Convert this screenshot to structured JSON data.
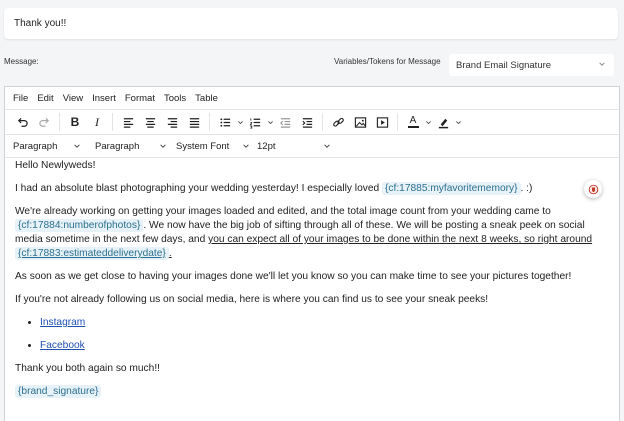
{
  "subject": {
    "value": "Thank you!!"
  },
  "message_label": "Message:",
  "variables": {
    "label": "Variables/Tokens for Message",
    "selected": "Brand Email Signature"
  },
  "menubar": {
    "items": [
      "File",
      "Edit",
      "View",
      "Insert",
      "Format",
      "Tools",
      "Table"
    ]
  },
  "formatbar": {
    "block1": "Paragraph",
    "block2": "Paragraph",
    "font": "System Font",
    "size": "12pt"
  },
  "toolbar": {
    "bold": "B",
    "italic": "I",
    "font_color": "A"
  },
  "body": {
    "greeting": "Hello Newlyweds!",
    "p1_text": "I had an absolute blast photographing your wedding yesterday! I especially loved ",
    "p1_token": "{cf:17885:myfavoritememory}",
    "p1_end": ". :)",
    "p2_text": "We're already working on getting your images loaded and edited, and the total image count from your wedding came to ",
    "p2_token1": "{cf:17884:numberofphotos}",
    "p2_mid": ". We now have the big job of sifting through all of these. We will be posting a sneak peek on social media sometime in the next few days, and ",
    "p2_underlined": "you can expect all of your images to be done within the next 8 weeks, so right around ",
    "p2_token2": "{cf:17883:estimateddeliverydate}",
    "p2_end": ".",
    "p3": "As soon as we get close to having your images done we'll let you know so you can make time to see your pictures together!",
    "p4": "If you're not already following us on social media, here is where you can find us to see your sneak peeks!",
    "links": [
      "Instagram",
      "Facebook"
    ],
    "p5": "Thank you both again so much!!",
    "signature_token": "{brand_signature}"
  },
  "colors": {
    "token_bg": "#e6f2f8",
    "token_text": "#2d6f8e",
    "link": "#1f4fb3",
    "fab_accent": "#c0392b"
  }
}
